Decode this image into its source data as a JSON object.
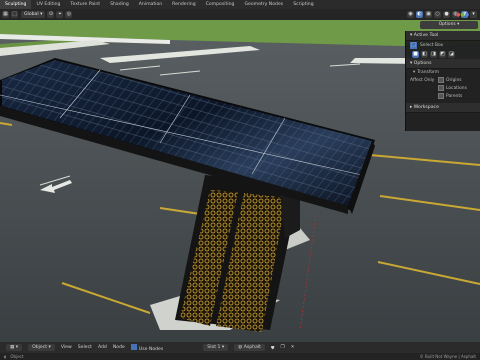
{
  "workspace_tabs": [
    "Sculpting",
    "UV Editing",
    "Texture Paint",
    "Shading",
    "Animation",
    "Rendering",
    "Compositing",
    "Geometry Nodes",
    "Scripting"
  ],
  "workspace_active_index": 0,
  "header": {
    "orientation_label": "Global",
    "options_label": "Options"
  },
  "npanel": {
    "active_tool_title": "Active Tool",
    "active_tool_value": "Select Box",
    "options_title": "Options",
    "transform_title": "Transform",
    "affect_only_label": "Affect Only",
    "affect_only_items": [
      "Origins",
      "Locations",
      "Parents"
    ],
    "workspace_title": "Workspace"
  },
  "bottom": {
    "mode_label": "Object",
    "menu": [
      "View",
      "Select",
      "Add",
      "Node"
    ],
    "use_nodes_label": "Use Nodes",
    "slot_label": "Slot 1",
    "material_label": "Asphalt"
  },
  "status": {
    "left_text": "Object",
    "right_text": "© Built Not Wayne | Asphalt"
  },
  "colors": {
    "asphalt": "#3f4447",
    "grass": "#6f9a47",
    "curb": "#e9ece6",
    "lane_yellow": "#c9a834",
    "pillar_gold": "#c8a23a",
    "solar_panel": "#0b1424",
    "accent": "#4772b3"
  },
  "icons": [
    "select-box-icon",
    "transform-icon",
    "overlay-icon",
    "shading-sphere-icon",
    "nav-gizmo-icon"
  ]
}
